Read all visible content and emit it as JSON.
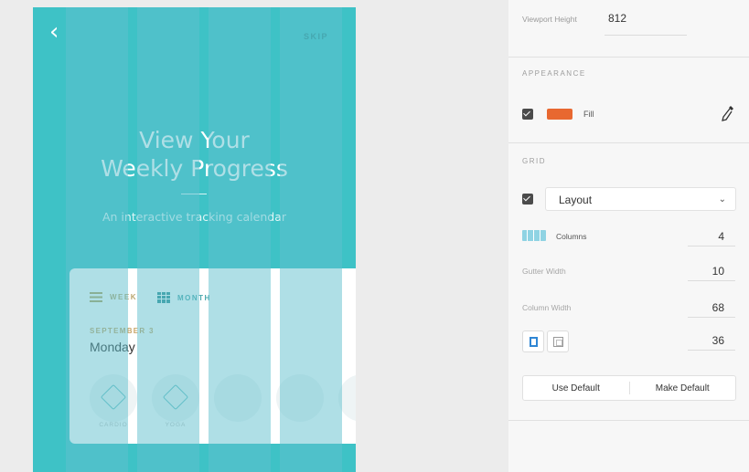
{
  "canvas": {
    "artboard_color": "#3ec2c6",
    "back_icon": "chevron-left-icon",
    "back_glyph": "‹",
    "skip_label": "SKIP",
    "hero_title_line1": "View Your",
    "hero_title_line2": "Weekly Progress",
    "hero_subtitle": "An interactive tracking calendar",
    "card": {
      "week_label": "WEEK",
      "month_label": "MONTH",
      "date_label": "SEPTEMBER 3",
      "day_label": "Monday",
      "day_captions": [
        "CARDIO",
        "YOGA"
      ]
    },
    "grid_color": "#60c0cd"
  },
  "panel": {
    "viewport_height_label": "Viewport Height",
    "viewport_height_value": "812",
    "appearance_title": "APPEARANCE",
    "fill_label": "Fill",
    "fill_color": "#e86830",
    "grid_title": "GRID",
    "layout_value": "Layout",
    "layout_chevron": "⌄",
    "columns_label": "Columns",
    "columns_value": "4",
    "gutter_width_label": "Gutter Width",
    "gutter_width_value": "10",
    "column_width_label": "Column Width",
    "column_width_value": "68",
    "margin_value": "36",
    "use_default_label": "Use Default",
    "make_default_label": "Make Default"
  }
}
